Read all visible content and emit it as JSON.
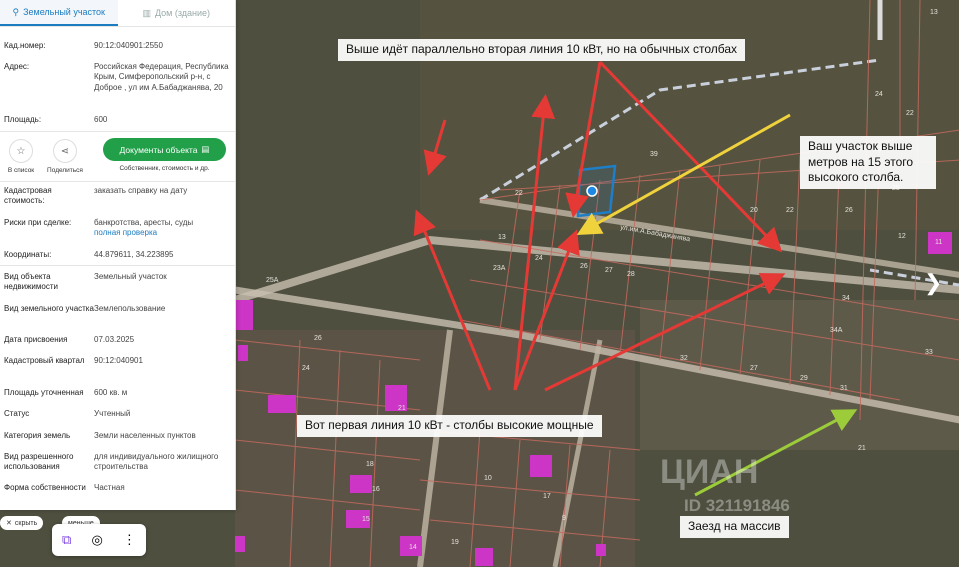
{
  "tabs": {
    "land": "Земельный участок",
    "house": "Дом (здание)"
  },
  "fields": {
    "cad_label": "Кад.номер:",
    "cad_value": "90:12:040901:2550",
    "addr_label": "Адрес:",
    "addr_value": "Российская Федерация, Республика Крым, Симферопольский р-н, с Доброе , ул им А.Бабаджанява, 20",
    "area_label": "Площадь:",
    "area_value": "600",
    "cost_label": "Кадастровая стоимость:",
    "cost_value": "заказать справку на дату",
    "risk_label": "Риски при сделке:",
    "risk_value": "банкротства, аресты, суды",
    "risk_link": "полная проверка",
    "coord_label": "Координаты:",
    "coord_value": "44.879611, 34.223895",
    "type_label": "Вид объекта недвижимости",
    "type_value": "Земельный участок",
    "kind_label": "Вид земельного участка",
    "kind_value": "Землепользование",
    "date_label": "Дата присвоения",
    "date_value": "07.03.2025",
    "quarter_label": "Кадастровый квартал",
    "quarter_value": "90:12:040901",
    "area2_label": "Площадь уточненная",
    "area2_value": "600 кв. м",
    "status_label": "Статус",
    "status_value": "Учтенный",
    "cat_label": "Категория земель",
    "cat_value": "Земли населенных пунктов",
    "use_label": "Вид разрешенного использования",
    "use_value": "для индивидуального жилищного строительства",
    "own_label": "Форма собственности",
    "own_value": "Частная"
  },
  "actions": {
    "list": "В список",
    "share": "Поделиться",
    "docs": "Документы объекта",
    "docs_sub": "Собственник, стоимость и др."
  },
  "chips": {
    "hide": "скрыть",
    "more": "меньше"
  },
  "callouts": {
    "top": "Выше идёт параллельно вторая линия 10 кВт, но на обычных  столбах",
    "right": "Ваш участок выше метров на 15 этого высокого столба.",
    "bottom": "Вот первая линия 10 кВт - столбы высокие мощные",
    "entry": "Заезд на массив"
  },
  "street_label": "ул.им.А.Бабаджанява",
  "plot_numbers": [
    "22",
    "39",
    "13",
    "24",
    "26",
    "27",
    "28",
    "23А",
    "25А",
    "26",
    "24",
    "21",
    "18",
    "16",
    "15",
    "14",
    "12",
    "34",
    "34А",
    "32",
    "13",
    "24",
    "22",
    "23",
    "25",
    "26",
    "22",
    "20",
    "33",
    "11",
    "10",
    "19",
    "17",
    "9",
    "21",
    "27",
    "29",
    "31"
  ],
  "watermark": {
    "brand": "ЦИАН",
    "id": "ID 321191846"
  },
  "icons": {
    "pin": "pin-icon",
    "house": "house-icon",
    "star": "star-icon",
    "share": "share-icon",
    "doc": "document-icon",
    "arrow": "arrow-right-icon"
  },
  "colors": {
    "accent": "#1c7cc0",
    "green": "#21a049",
    "arrow_red": "#e53935",
    "arrow_yellow": "#f0d23c",
    "arrow_green": "#9ccc3a"
  }
}
